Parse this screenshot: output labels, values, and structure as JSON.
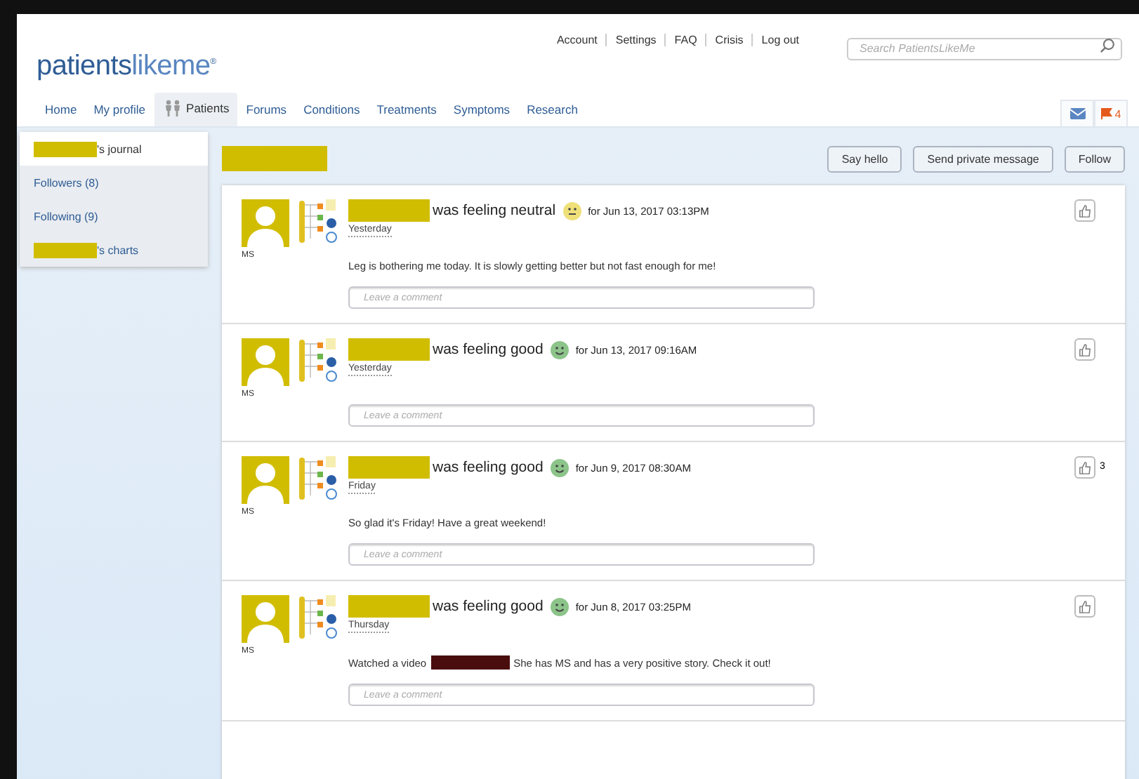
{
  "header": {
    "logo": {
      "part1": "patients",
      "part2": "likeme",
      "mark": "®"
    },
    "top_links": [
      "Account",
      "Settings",
      "FAQ",
      "Crisis",
      "Log out"
    ],
    "search": {
      "placeholder": "Search PatientsLikeMe"
    },
    "nav": [
      {
        "label": "Home",
        "selected": false
      },
      {
        "label": "My profile",
        "selected": false
      },
      {
        "label": "Patients",
        "selected": true,
        "icon": true
      },
      {
        "label": "Forums",
        "selected": false
      },
      {
        "label": "Conditions",
        "selected": false
      },
      {
        "label": "Treatments",
        "selected": false
      },
      {
        "label": "Symptoms",
        "selected": false
      },
      {
        "label": "Research",
        "selected": false
      }
    ],
    "flag_count": "4"
  },
  "sidebar": {
    "items": [
      {
        "redacted_prefix": true,
        "label": "'s journal",
        "selected": true
      },
      {
        "redacted_prefix": false,
        "label": "Followers (8)",
        "selected": false
      },
      {
        "redacted_prefix": false,
        "label": "Following (9)",
        "selected": false
      },
      {
        "redacted_prefix": true,
        "label": "'s charts",
        "selected": false
      }
    ]
  },
  "actions": [
    "Say hello",
    "Send private message",
    "Follow"
  ],
  "posts": [
    {
      "avatar_label": "MS",
      "status": "was feeling neutral",
      "kind": "neutral",
      "date": "for Jun 13, 2017 03:13PM",
      "day": "Yesterday",
      "body": [
        {
          "kind": "text",
          "text": "Leg is bothering me today. It is slowly getting better but not fast enough for me!"
        }
      ],
      "comment_placeholder": "Leave a comment"
    },
    {
      "avatar_label": "MS",
      "status": "was feeling good",
      "kind": "good",
      "date": "for Jun 13, 2017 09:16AM",
      "day": "Yesterday",
      "comment_placeholder": "Leave a comment"
    },
    {
      "avatar_label": "MS",
      "status": "was feeling good",
      "kind": "good",
      "date": "for Jun 9, 2017 08:30AM",
      "day": "Friday",
      "body": [
        {
          "kind": "text",
          "text": "So glad it's Friday! Have a great weekend!"
        }
      ],
      "likes": "3",
      "comment_placeholder": "Leave a comment"
    },
    {
      "avatar_label": "MS",
      "status": "was feeling good",
      "kind": "good",
      "date": "for Jun 8, 2017 03:25PM",
      "day": "Thursday",
      "body": [
        {
          "kind": "text",
          "text": "Watched a video"
        },
        {
          "kind": "redacted"
        },
        {
          "kind": "text",
          "text": "She has MS and has a very positive story. Check it out!"
        }
      ],
      "comment_placeholder": "Leave a comment"
    }
  ]
}
